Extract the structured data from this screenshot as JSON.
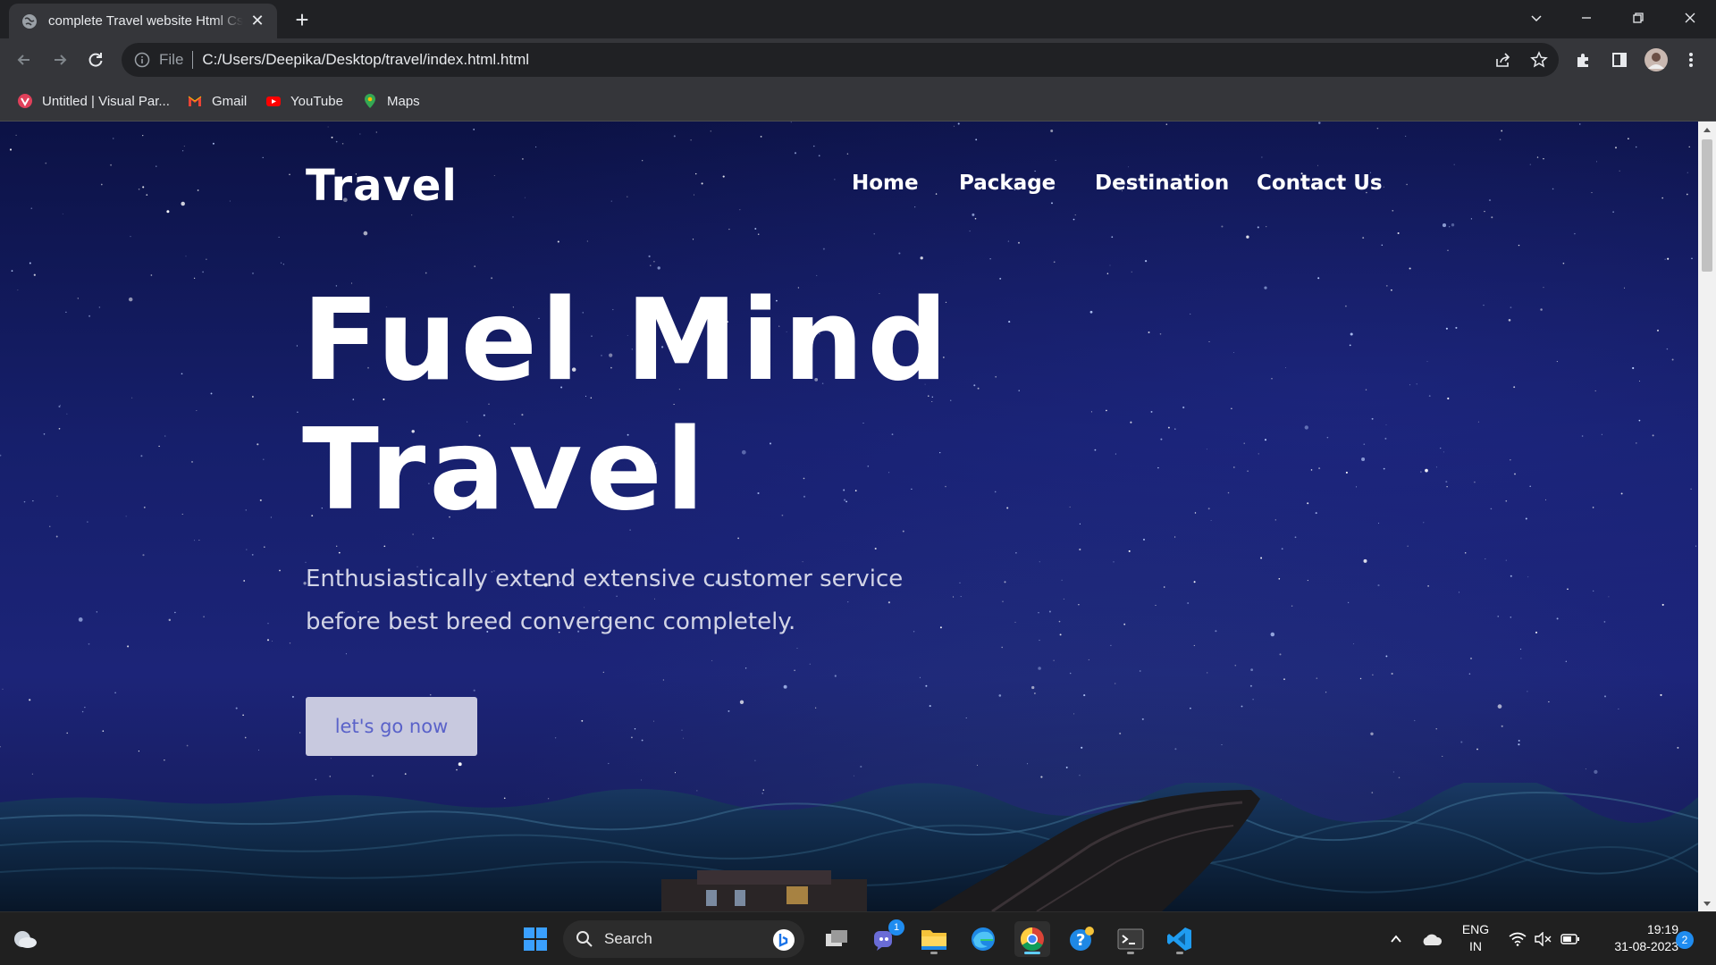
{
  "browser": {
    "tab_title": "complete Travel website Html Css",
    "new_tab_label": "+",
    "close_tab_label": "✕",
    "url_scheme": "File",
    "url": "C:/Users/Deepika/Desktop/travel/index.html.html",
    "bookmarks": [
      {
        "label": "Untitled | Visual Par...",
        "icon": "visual-paradigm-icon"
      },
      {
        "label": "Gmail",
        "icon": "gmail-icon"
      },
      {
        "label": "YouTube",
        "icon": "youtube-icon"
      },
      {
        "label": "Maps",
        "icon": "maps-icon"
      }
    ]
  },
  "site": {
    "logo": "Travel",
    "nav": [
      "Home",
      "Package",
      "Destination",
      "Contact Us"
    ],
    "hero_title_line1": "Fuel Mind",
    "hero_title_line2": "Travel",
    "hero_subtitle": "Enthusiastically extend extensive customer service before best breed convergenc completely.",
    "cta_label": "let's go now"
  },
  "taskbar": {
    "search_label": "Search",
    "teams_badge": "1",
    "lang_line1": "ENG",
    "lang_line2": "IN",
    "time": "19:19",
    "date": "31-08-2023",
    "notification_count": "2"
  },
  "colors": {
    "sky_top": "#0c1245",
    "sky_mid": "#1c2478",
    "cta_bg": "#c8c9df",
    "cta_text": "#5a62c9",
    "chrome_dark": "#202124",
    "chrome_toolbar": "#35363a"
  }
}
